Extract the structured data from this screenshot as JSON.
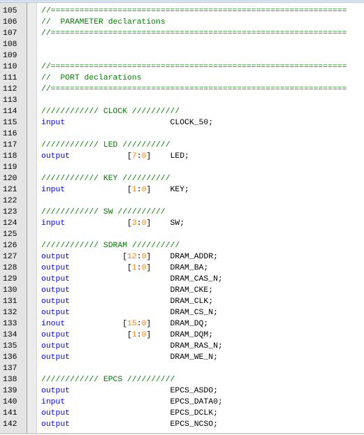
{
  "editor": {
    "lines": [
      {
        "n": "105",
        "comment": "//=============================================================="
      },
      {
        "n": "106",
        "comment": "//  PARAMETER declarations"
      },
      {
        "n": "107",
        "comment": "//=============================================================="
      },
      {
        "n": "108"
      },
      {
        "n": "109"
      },
      {
        "n": "110",
        "comment": "//=============================================================="
      },
      {
        "n": "111",
        "comment": "//  PORT declarations"
      },
      {
        "n": "112",
        "comment": "//=============================================================="
      },
      {
        "n": "113"
      },
      {
        "n": "114",
        "comment": "//////////// CLOCK //////////"
      },
      {
        "n": "115",
        "kw": "input",
        "sig": "CLOCK_50;"
      },
      {
        "n": "116"
      },
      {
        "n": "117",
        "comment": "//////////// LED //////////"
      },
      {
        "n": "118",
        "kw": "output",
        "br1": "[",
        "hi": "7",
        "col": ":",
        "lo": "0",
        "br2": "]",
        "sig": "LED;"
      },
      {
        "n": "119"
      },
      {
        "n": "120",
        "comment": "//////////// KEY //////////"
      },
      {
        "n": "121",
        "kw": "input",
        "br1": "[",
        "hi": "1",
        "col": ":",
        "lo": "0",
        "br2": "]",
        "sig": "KEY;"
      },
      {
        "n": "122"
      },
      {
        "n": "123",
        "comment": "//////////// SW //////////"
      },
      {
        "n": "124",
        "kw": "input",
        "br1": "[",
        "hi": "3",
        "col": ":",
        "lo": "0",
        "br2": "]",
        "sig": "SW;"
      },
      {
        "n": "125"
      },
      {
        "n": "126",
        "comment": "//////////// SDRAM //////////"
      },
      {
        "n": "127",
        "kw": "output",
        "br1": "[",
        "hi": "12",
        "col": ":",
        "lo": "0",
        "br2": "]",
        "sig": "DRAM_ADDR;"
      },
      {
        "n": "128",
        "kw": "output",
        "br1": "[",
        "hi": "1",
        "col": ":",
        "lo": "0",
        "br2": "]",
        "sig": "DRAM_BA;"
      },
      {
        "n": "129",
        "kw": "output",
        "sig": "DRAM_CAS_N;"
      },
      {
        "n": "130",
        "kw": "output",
        "sig": "DRAM_CKE;"
      },
      {
        "n": "131",
        "kw": "output",
        "sig": "DRAM_CLK;"
      },
      {
        "n": "132",
        "kw": "output",
        "sig": "DRAM_CS_N;"
      },
      {
        "n": "133",
        "kw": "inout",
        "br1": "[",
        "hi": "15",
        "col": ":",
        "lo": "0",
        "br2": "]",
        "sig": "DRAM_DQ;"
      },
      {
        "n": "134",
        "kw": "output",
        "br1": "[",
        "hi": "1",
        "col": ":",
        "lo": "0",
        "br2": "]",
        "sig": "DRAM_DQM;"
      },
      {
        "n": "135",
        "kw": "output",
        "sig": "DRAM_RAS_N;"
      },
      {
        "n": "136",
        "kw": "output",
        "sig": "DRAM_WE_N;"
      },
      {
        "n": "137"
      },
      {
        "n": "138",
        "comment": "//////////// EPCS //////////"
      },
      {
        "n": "139",
        "kw": "output",
        "sig": "EPCS_ASDO;"
      },
      {
        "n": "140",
        "kw": "input",
        "sig": "EPCS_DATA0;"
      },
      {
        "n": "141",
        "kw": "output",
        "sig": "EPCS_DCLK;"
      },
      {
        "n": "142",
        "kw": "output",
        "sig": "EPCS_NCSO;"
      }
    ]
  },
  "colors": {
    "comment": "#008000",
    "keyword": "#0000ff",
    "number": "#ff8000",
    "gutter": "#e4e4e4"
  }
}
